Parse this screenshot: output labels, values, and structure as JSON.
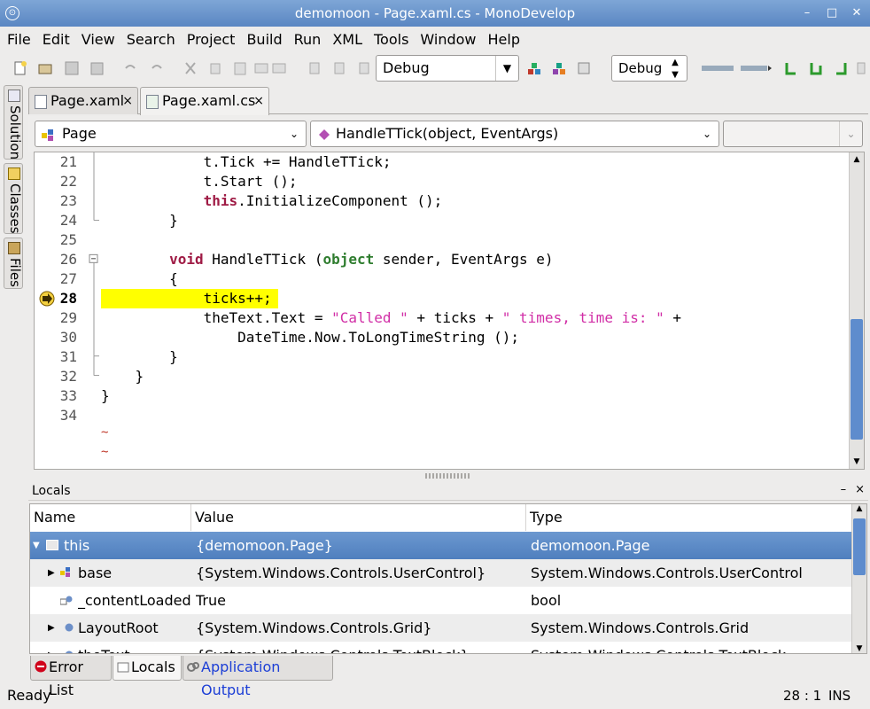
{
  "window": {
    "title": "demomoon - Page.xaml.cs - MonoDevelop"
  },
  "menu": [
    "File",
    "Edit",
    "View",
    "Search",
    "Project",
    "Build",
    "Run",
    "XML",
    "Tools",
    "Window",
    "Help"
  ],
  "toolbar": {
    "config": "Debug",
    "platform": "Debug"
  },
  "dock_left": {
    "solution": "Solution",
    "classes": "Classes",
    "files": "Files"
  },
  "tabs": [
    {
      "label": "Page.xaml",
      "close": "×"
    },
    {
      "label": "Page.xaml.cs",
      "close": "×"
    }
  ],
  "nav": {
    "class": "Page",
    "member": "HandleTTick(object, EventArgs)"
  },
  "editor": {
    "lines": [
      {
        "n": "21",
        "code": "            t.Tick += HandleTTick;"
      },
      {
        "n": "22",
        "code": "            t.Start ();"
      },
      {
        "n": "23",
        "pre": "            ",
        "kw": "this",
        "post": ".InitializeComponent ();"
      },
      {
        "n": "24",
        "code": "        }"
      },
      {
        "n": "25",
        "code": ""
      },
      {
        "n": "26",
        "pre": "        ",
        "kw": "void",
        "mid": " HandleTTick (",
        "kw2": "object",
        "post": " sender, EventArgs e)"
      },
      {
        "n": "27",
        "code": "        {"
      },
      {
        "n": "28",
        "code": "            ticks++;"
      },
      {
        "n": "29",
        "pre": "            theText.Text = ",
        "s1": "\"Called \"",
        "mid": " + ticks + ",
        "s2": "\" times, time is: \"",
        "post": " +"
      },
      {
        "n": "30",
        "code": "                DateTime.Now.ToLongTimeString ();"
      },
      {
        "n": "31",
        "code": "        }"
      },
      {
        "n": "32",
        "code": "    }"
      },
      {
        "n": "33",
        "code": "}"
      },
      {
        "n": "34",
        "code": ""
      }
    ],
    "eof_marker": "~"
  },
  "locals": {
    "title": "Locals",
    "pad_buttons": [
      "–",
      "×"
    ],
    "columns": [
      "Name",
      "Value",
      "Type"
    ],
    "rows": [
      {
        "name": "this",
        "value": "{demomoon.Page}",
        "type": "demomoon.Page"
      },
      {
        "name": "base",
        "value": "{System.Windows.Controls.UserControl}",
        "type": "System.Windows.Controls.UserControl"
      },
      {
        "name": "_contentLoaded",
        "value": "True",
        "type": "bool"
      },
      {
        "name": "LayoutRoot",
        "value": "{System.Windows.Controls.Grid}",
        "type": "System.Windows.Controls.Grid"
      },
      {
        "name": "theText",
        "value": "{System.Windows.Controls.TextBlock}",
        "type": "System.Windows.Controls.TextBlock"
      }
    ]
  },
  "pad_tabs": [
    "Error List",
    "Locals",
    "Application Output"
  ],
  "status": {
    "text": "Ready",
    "position": "28 : 1",
    "mode": "INS"
  }
}
